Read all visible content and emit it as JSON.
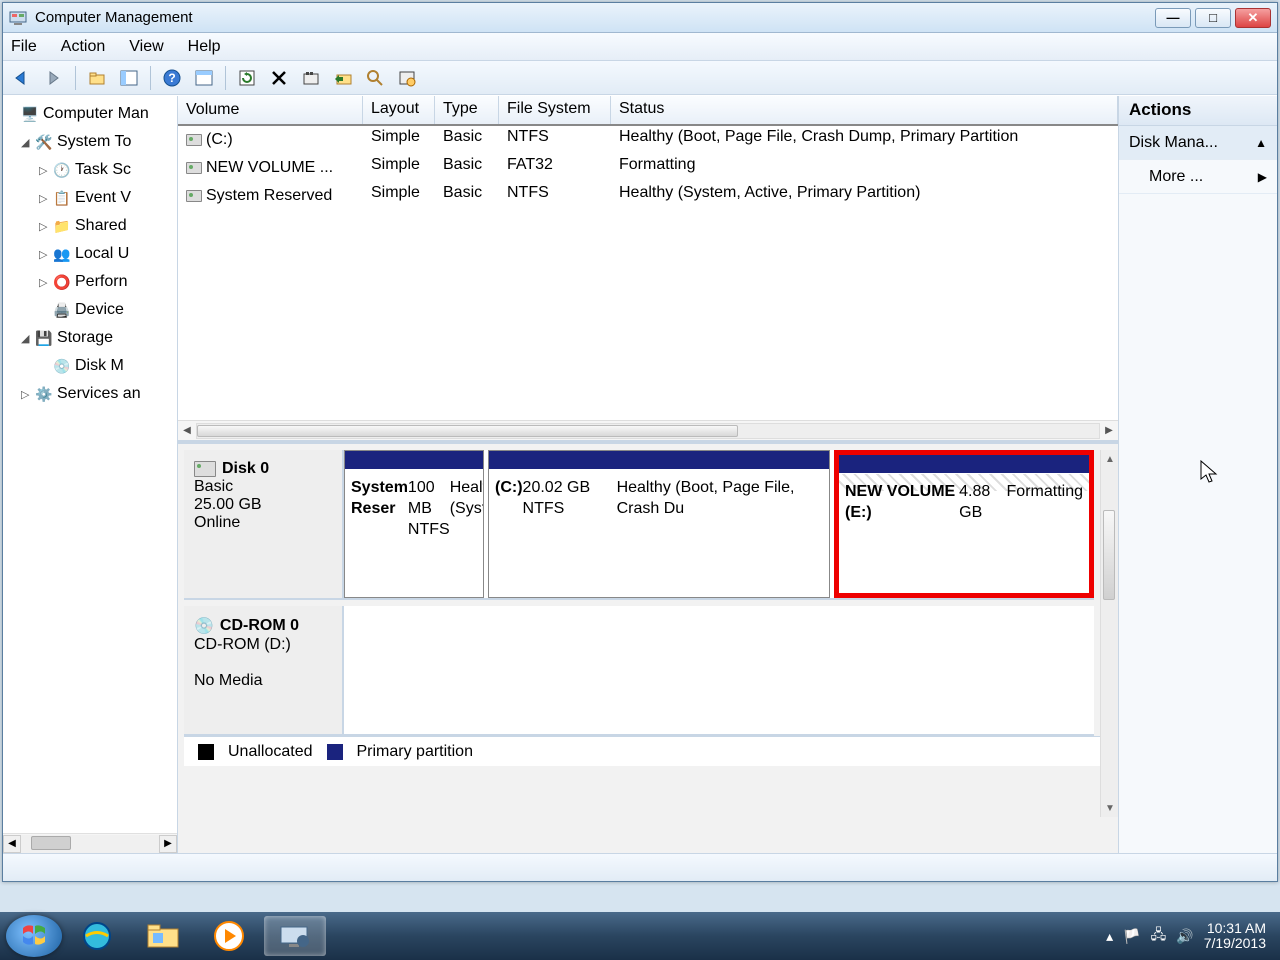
{
  "window": {
    "title": "Computer Management"
  },
  "menu": {
    "file": "File",
    "action": "Action",
    "view": "View",
    "help": "Help"
  },
  "tree": {
    "root": "Computer Man",
    "systools": "System To",
    "task": "Task Sc",
    "event": "Event V",
    "shared": "Shared",
    "localu": "Local U",
    "perf": "Perforn",
    "device": "Device",
    "storage": "Storage",
    "diskm": "Disk M",
    "services": "Services an"
  },
  "vol_headers": {
    "volume": "Volume",
    "layout": "Layout",
    "type": "Type",
    "fs": "File System",
    "status": "Status"
  },
  "volumes": [
    {
      "name": "(C:)",
      "layout": "Simple",
      "type": "Basic",
      "fs": "NTFS",
      "status": "Healthy (Boot, Page File, Crash Dump, Primary Partition"
    },
    {
      "name": "NEW VOLUME ...",
      "layout": "Simple",
      "type": "Basic",
      "fs": "FAT32",
      "status": "Formatting"
    },
    {
      "name": "System Reserved",
      "layout": "Simple",
      "type": "Basic",
      "fs": "NTFS",
      "status": "Healthy (System, Active, Primary Partition)"
    }
  ],
  "disk0": {
    "name": "Disk 0",
    "type": "Basic",
    "size": "25.00 GB",
    "state": "Online",
    "parts": [
      {
        "title": "System Reser",
        "line2": "100 MB NTFS",
        "line3": "Healthy (Syste"
      },
      {
        "title": "  (C:)",
        "line2": "20.02 GB NTFS",
        "line3": "Healthy (Boot, Page File, Crash Du"
      },
      {
        "title": "NEW VOLUME  (E:)",
        "line2": "4.88 GB",
        "line3": "Formatting"
      }
    ]
  },
  "cdrom": {
    "name": "CD-ROM 0",
    "desc": "CD-ROM (D:)",
    "state": "No Media"
  },
  "legend": {
    "unalloc": "Unallocated",
    "primary": "Primary partition"
  },
  "actions": {
    "header": "Actions",
    "diskm": "Disk Mana...",
    "more": "More ..."
  },
  "tray": {
    "time": "10:31 AM",
    "date": "7/19/2013"
  }
}
